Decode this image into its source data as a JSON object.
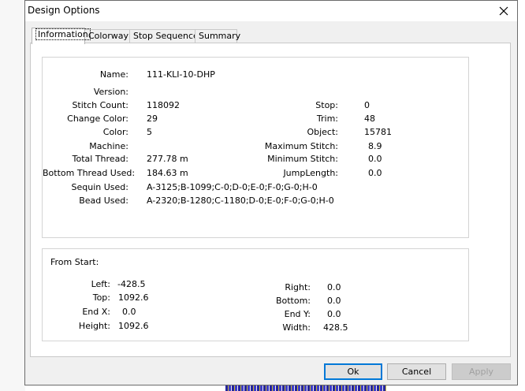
{
  "window": {
    "title": "Design Options"
  },
  "tabs": [
    {
      "label": "Information",
      "active": true
    },
    {
      "label": "Colorway",
      "active": false
    },
    {
      "label": "Stop Sequence",
      "active": false
    },
    {
      "label": "Summary",
      "active": false
    }
  ],
  "info": {
    "name": {
      "label": "Name:",
      "value": "111-KLI-10-DHP"
    },
    "version": {
      "label": "Version:",
      "value": ""
    },
    "stitch_count": {
      "label": "Stitch Count:",
      "value": "118092"
    },
    "change_color": {
      "label": "Change Color:",
      "value": "29"
    },
    "color": {
      "label": "Color:",
      "value": "5"
    },
    "machine": {
      "label": "Machine:",
      "value": ""
    },
    "total_thread": {
      "label": "Total Thread:",
      "value": "277.78 m"
    },
    "bottom_thread": {
      "label": "Bottom Thread Used:",
      "value": "184.63 m"
    },
    "sequin_used": {
      "label": "Sequin Used:",
      "value": "A-3125;B-1099;C-0;D-0;E-0;F-0;G-0;H-0"
    },
    "bead_used": {
      "label": "Bead Used:",
      "value": "A-2320;B-1280;C-1180;D-0;E-0;F-0;G-0;H-0"
    },
    "stop": {
      "label": "Stop:",
      "value": "0"
    },
    "trim": {
      "label": "Trim:",
      "value": "48"
    },
    "object": {
      "label": "Object:",
      "value": "15781"
    },
    "max_stitch": {
      "label": "Maximum Stitch:",
      "value": "8.9"
    },
    "min_stitch": {
      "label": "Minimum Stitch:",
      "value": "0.0"
    },
    "jump_length": {
      "label": "JumpLength:",
      "value": "0.0"
    }
  },
  "from_start": {
    "title": "From Start:",
    "left": {
      "label": "Left:",
      "value": "-428.5"
    },
    "top": {
      "label": "Top:",
      "value": "1092.6"
    },
    "end_x": {
      "label": "End X:",
      "value": "0.0"
    },
    "height": {
      "label": "Height:",
      "value": "1092.6"
    },
    "right": {
      "label": "Right:",
      "value": "0.0"
    },
    "bottom": {
      "label": "Bottom:",
      "value": "0.0"
    },
    "end_y": {
      "label": "End Y:",
      "value": "0.0"
    },
    "width": {
      "label": "Width:",
      "value": "428.5"
    }
  },
  "buttons": {
    "ok": "Ok",
    "cancel": "Cancel",
    "apply": "Apply"
  },
  "icons": {
    "close": "close-icon"
  }
}
